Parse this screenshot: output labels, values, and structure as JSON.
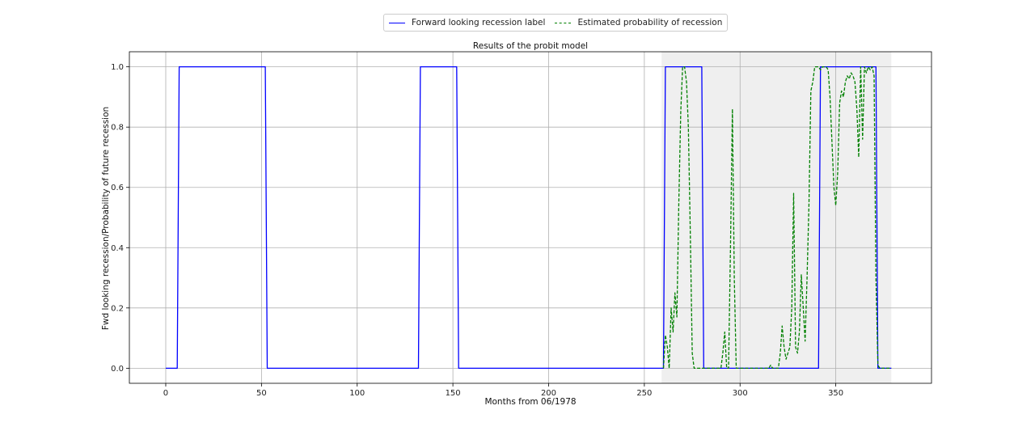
{
  "chart_data": {
    "type": "line",
    "title": "Results of the probit model",
    "xlabel": "Months from 06/1978",
    "ylabel": "Fwd looking recession/Probability of future recession",
    "xlim": [
      -19,
      400
    ],
    "ylim": [
      -0.05,
      1.05
    ],
    "xticks": [
      0,
      50,
      100,
      150,
      200,
      250,
      300,
      350
    ],
    "yticks": [
      "0.0",
      "0.2",
      "0.4",
      "0.6",
      "0.8",
      "1.0"
    ],
    "grid": true,
    "legend": {
      "placement": "top-center"
    },
    "shaded_region": {
      "x": [
        259,
        379
      ],
      "color": "#efefef"
    },
    "series": [
      {
        "name": "Forward looking recession label",
        "style": "solid",
        "color": "#0000ff",
        "x": [
          0,
          6,
          7,
          52,
          53,
          132,
          133,
          152,
          153,
          260,
          261,
          280,
          281,
          341,
          342,
          371,
          372,
          379
        ],
        "values": [
          0,
          0,
          1,
          1,
          0,
          0,
          1,
          1,
          0,
          0,
          1,
          1,
          0,
          0,
          1,
          1,
          0,
          0
        ]
      },
      {
        "name": "Estimated probability of recession",
        "style": "dashed",
        "color": "#008000",
        "x": [
          260,
          261,
          262,
          263,
          264,
          265,
          266,
          267,
          268,
          269,
          270,
          271,
          272,
          273,
          274,
          275,
          276,
          277,
          278,
          279,
          280,
          281,
          282,
          285,
          290,
          291,
          292,
          293,
          294,
          295,
          296,
          297,
          298,
          299,
          300,
          305,
          310,
          315,
          316,
          317,
          318,
          319,
          320,
          321,
          322,
          323,
          324,
          325,
          326,
          327,
          328,
          329,
          330,
          331,
          332,
          333,
          334,
          335,
          336,
          337,
          338,
          339,
          340,
          341,
          342,
          343,
          344,
          345,
          346,
          347,
          348,
          349,
          350,
          351,
          352,
          353,
          354,
          355,
          356,
          357,
          358,
          359,
          360,
          361,
          362,
          363,
          364,
          365,
          366,
          367,
          368,
          369,
          370,
          371,
          372,
          373,
          374,
          375,
          376,
          377,
          378,
          379
        ],
        "values": [
          0.0,
          0.11,
          0.07,
          0.0,
          0.2,
          0.12,
          0.25,
          0.17,
          0.55,
          0.85,
          1.0,
          1.0,
          0.95,
          0.8,
          0.45,
          0.05,
          0.0,
          0.0,
          0.0,
          0.0,
          0.0,
          0.0,
          0.0,
          0.0,
          0.0,
          0.05,
          0.12,
          0.0,
          0.0,
          0.4,
          0.86,
          0.3,
          0.0,
          0.0,
          0.0,
          0.0,
          0.0,
          0.0,
          0.01,
          0.0,
          0.0,
          0.0,
          0.0,
          0.05,
          0.14,
          0.07,
          0.03,
          0.05,
          0.07,
          0.2,
          0.58,
          0.07,
          0.05,
          0.12,
          0.31,
          0.2,
          0.09,
          0.3,
          0.55,
          0.92,
          0.95,
          1.0,
          1.0,
          1.0,
          0.99,
          1.0,
          1.0,
          1.0,
          0.99,
          0.9,
          0.75,
          0.6,
          0.54,
          0.65,
          0.88,
          0.92,
          0.9,
          0.95,
          0.97,
          0.96,
          0.98,
          0.97,
          0.95,
          0.86,
          0.7,
          1.0,
          0.76,
          1.0,
          0.98,
          1.0,
          0.99,
          1.0,
          0.97,
          0.3,
          0.01,
          0.0,
          0.0,
          0.0,
          0.0,
          0.0,
          0.0,
          0.0
        ]
      }
    ]
  }
}
